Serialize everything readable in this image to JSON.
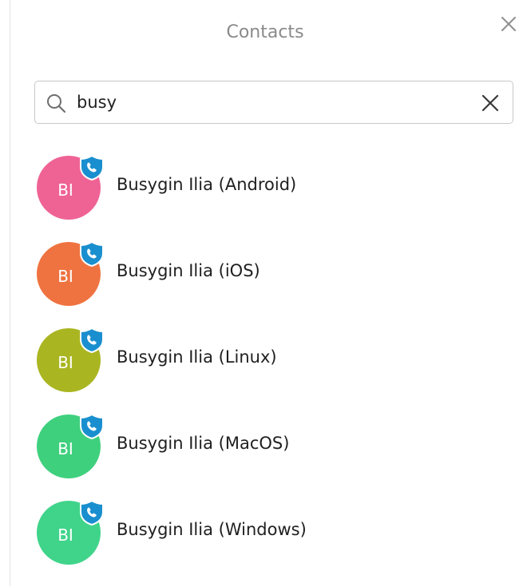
{
  "dialog": {
    "title": "Contacts"
  },
  "search": {
    "value": "busy"
  },
  "contacts": [
    {
      "initials": "BI",
      "name": "Busygin Ilia (Android)",
      "color": "#ef6394"
    },
    {
      "initials": "BI",
      "name": "Busygin Ilia (iOS)",
      "color": "#ef7340"
    },
    {
      "initials": "BI",
      "name": "Busygin Ilia (Linux)",
      "color": "#aab621"
    },
    {
      "initials": "BI",
      "name": "Busygin Ilia (MacOS)",
      "color": "#3fd07e"
    },
    {
      "initials": "BI",
      "name": "Busygin Ilia (Windows)",
      "color": "#3fd48a"
    }
  ],
  "icons": {
    "close": "close-icon",
    "search": "search-icon",
    "clear": "clear-icon",
    "badge": "phone-shield-icon"
  },
  "colors": {
    "badge": "#1a8fcf"
  }
}
